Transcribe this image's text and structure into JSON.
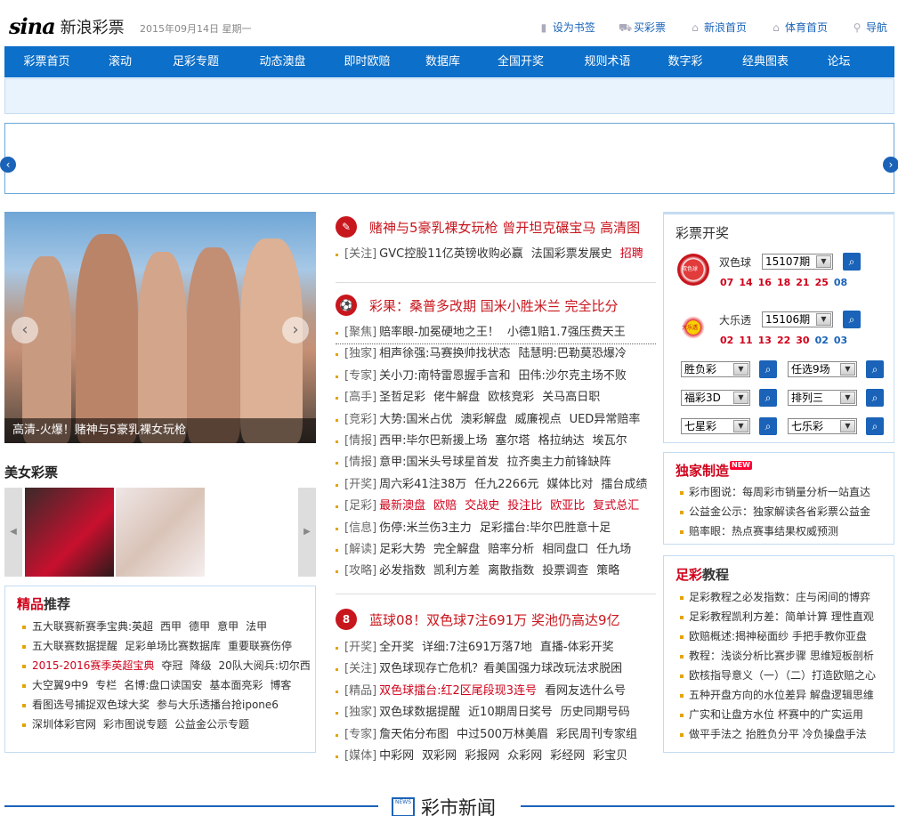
{
  "header": {
    "logo_text": "sina",
    "site_name": "新浪彩票",
    "date": "2015年09月14日  星期一",
    "links": [
      "设为书签",
      "买彩票",
      "新浪首页",
      "体育首页",
      "导航"
    ]
  },
  "nav": [
    "彩票首页",
    "滚动",
    "足彩专题",
    "动态澳盘",
    "即时欧赔",
    "数据库",
    "全国开奖",
    "规则术语",
    "数字彩",
    "经典图表",
    "论坛"
  ],
  "photo": {
    "caption": "高清-火爆！赌神与5豪乳裸女玩枪"
  },
  "beauty": {
    "title": "美女彩票"
  },
  "recommend": {
    "title_red": "精品",
    "title_rest": "推荐",
    "rows": [
      [
        "五大联赛新赛季宝典:英超",
        "西甲",
        "德甲",
        "意甲",
        "法甲"
      ],
      [
        "五大联赛数据提醒",
        "足彩单场比赛数据库",
        "重要联赛伤停"
      ],
      [
        "2015-2016赛季英超宝典",
        "夺冠",
        "降级",
        "20队大阅兵:切尔西"
      ],
      [
        "大空翼9中9",
        "专栏",
        "名博:盘口读国安",
        "基本面亮彩",
        "博客"
      ],
      [
        "看图选号捕捉双色球大奖",
        "参与大乐透播台抢ipone6"
      ],
      [
        "深圳体彩官网",
        "彩市图说专题",
        "公益金公示专题"
      ]
    ]
  },
  "center": {
    "h1": "赌神与5豪乳裸女玩枪 曾开坦克碾宝马 高清图",
    "h1_item": {
      "tag": "[关注]",
      "words": [
        "GVC控股11亿英镑收购必赢",
        "法国彩票发展史"
      ],
      "red": "招聘"
    },
    "h2": "彩果：桑普多改期 国米小胜米兰 完全比分",
    "h2_items": [
      {
        "tag": "[聚焦]",
        "words": [
          "赔率眼-加冕硬地之王！",
          "小德1赔1.7强压费天王"
        ]
      },
      {
        "tag": "[独家]",
        "words": [
          "相声徐强:马赛换帅找状态",
          "陆慧明:巴勒莫恐爆冷"
        ]
      },
      {
        "tag": "[专家]",
        "words": [
          "关小刀:南特雷恩握手言和",
          "田伟:沙尔克主场不败"
        ]
      },
      {
        "tag": "[高手]",
        "words": [
          "圣哲足彩",
          "佬牛解盘",
          "欧核竞彩",
          "关马高日职"
        ]
      },
      {
        "tag": "[竞彩]",
        "words": [
          "大势:国米占优",
          "澳彩解盘",
          "威廉视点",
          "UED异常赔率"
        ]
      },
      {
        "tag": "[情报]",
        "words": [
          "西甲:毕尔巴新援上场",
          "塞尔塔",
          "格拉纳达",
          "埃瓦尔"
        ]
      },
      {
        "tag": "[情报]",
        "words": [
          "意甲:国米头号球星首发",
          "拉齐奥主力前锋缺阵"
        ]
      },
      {
        "tag": "[开奖]",
        "words": [
          "周六彩41注38万",
          "任九2266元",
          "媒体比对",
          "擂台成绩"
        ]
      },
      {
        "tag": "[足彩]",
        "red": [
          "最新澳盘",
          "欧赔",
          "交战史",
          "投注比",
          "欧亚比",
          "复式总汇"
        ]
      },
      {
        "tag": "[信息]",
        "words": [
          "伤停:米兰伤3主力",
          "足彩擂台:毕尔巴胜意十足"
        ]
      },
      {
        "tag": "[解读]",
        "words": [
          "足彩大势",
          "完全解盘",
          "赔率分析",
          "相同盘口",
          "任九场"
        ]
      },
      {
        "tag": "[攻略]",
        "words": [
          "必发指数",
          "凯利方差",
          "离散指数",
          "投票调查",
          "策略"
        ]
      }
    ],
    "h3": "蓝球08！双色球7注691万 奖池仍高达9亿",
    "h3_items": [
      {
        "tag": "[开奖]",
        "words": [
          "全开奖",
          "详细:7注691万落7地",
          "直播-体彩开奖"
        ]
      },
      {
        "tag": "[关注]",
        "words": [
          "双色球现存亡危机？看美国强力球改玩法求脱困"
        ]
      },
      {
        "tag": "[精品]",
        "red": [
          "双色球擂台:红2区尾段现3连号"
        ],
        "words": [
          "看网友选什么号"
        ]
      },
      {
        "tag": "[独家]",
        "words": [
          "双色球数据提醒",
          "近10期周日奖号",
          "历史同期号码"
        ]
      },
      {
        "tag": "[专家]",
        "words": [
          "詹天佑分布图",
          "中过500万林美眉",
          "彩民周刊专家组"
        ]
      },
      {
        "tag": "[媒体]",
        "words": [
          "中彩网",
          "双彩网",
          "彩报网",
          "众彩网",
          "彩经网",
          "彩宝贝"
        ]
      }
    ]
  },
  "lottery": {
    "title": "彩票开奖",
    "ssq": {
      "name": "双色球",
      "issue": "15107期",
      "red": [
        "07",
        "14",
        "16",
        "18",
        "21",
        "25"
      ],
      "blue": [
        "08"
      ]
    },
    "dlt": {
      "name": "大乐透",
      "issue": "15106期",
      "red": [
        "02",
        "11",
        "13",
        "22",
        "30"
      ],
      "blue": [
        "02",
        "03"
      ]
    },
    "selects": [
      "胜负彩",
      "任选9场",
      "福彩3D",
      "排列三",
      "七星彩",
      "七乐彩"
    ],
    "logo_ssq": "双色球",
    "logo_dlt": "大乐透"
  },
  "exclusive": {
    "title_red": "独家制造",
    "badge": "NEW",
    "items": [
      "彩市图说：每周彩市销量分析一站直达",
      "公益金公示：独家解读各省彩票公益金",
      "赔率眼：热点赛事结果权威预测"
    ]
  },
  "tutorial": {
    "title_red": "足彩",
    "title_rest": "教程",
    "items": [
      "足彩教程之必发指数：庄与闲间的博弈",
      "足彩教程凯利方差：简单计算  理性直观",
      "欧赔概述:揭神秘面纱  手把手教你亚盘",
      "教程：浅谈分析比赛步骤  思维短板剖析",
      "欧核指导意义（一）（二）打造欧赔之心",
      "五种开盘方向的水位差异  解盘逻辑思维",
      "广实和让盘方水位  杯赛中的广实运用",
      "做平手法之  抬胜负分平  冷负操盘手法"
    ]
  },
  "bottom": {
    "title": "彩市新闻",
    "icon_text": "NEWS"
  },
  "colors": {
    "nav_blue": "#0c6fc9",
    "accent_red": "#d0021b",
    "link_blue": "#1a63b8"
  }
}
